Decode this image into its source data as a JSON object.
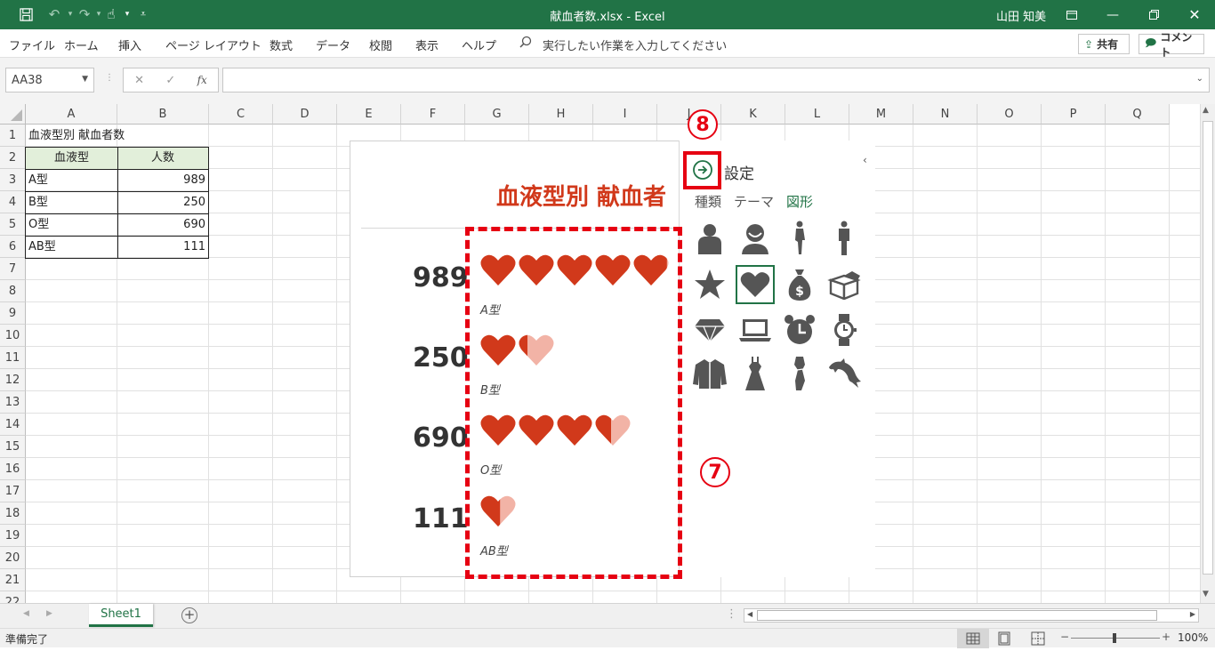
{
  "titlebar": {
    "title": "献血者数.xlsx  -  Excel",
    "user": "山田 知美",
    "colors": {
      "bg": "#217346"
    }
  },
  "menu": {
    "items": [
      "ファイル",
      "ホーム",
      "挿入",
      "ページ レイアウト",
      "数式",
      "データ",
      "校閲",
      "表示",
      "ヘルプ"
    ],
    "tellme": "実行したい作業を入力してください",
    "share": "共有",
    "comment": "コメント"
  },
  "formula": {
    "namebox": "AA38",
    "fx": "fx",
    "value": ""
  },
  "columns": [
    "A",
    "B",
    "C",
    "D",
    "E",
    "F",
    "G",
    "H",
    "I",
    "J",
    "K",
    "L",
    "M",
    "N",
    "O",
    "P",
    "Q"
  ],
  "rows": [
    "1",
    "2",
    "3",
    "4",
    "5",
    "6",
    "7",
    "8",
    "9",
    "10",
    "11",
    "12",
    "13",
    "14",
    "15",
    "16",
    "17",
    "18",
    "19",
    "20",
    "21",
    "22"
  ],
  "sheet": {
    "a1": "血液型別 献血者数",
    "header_a": "血液型",
    "header_b": "人数",
    "r3a": "A型",
    "r3b": "989",
    "r4a": "B型",
    "r4b": "250",
    "r5a": "O型",
    "r5b": "690",
    "r6a": "AB型",
    "r6b": "111"
  },
  "chart_data": {
    "type": "bar",
    "title": "血液型別 献血者",
    "categories": [
      "A型",
      "B型",
      "O型",
      "AB型"
    ],
    "values": [
      989,
      250,
      690,
      111
    ],
    "icon": "heart-icon",
    "color": "#d1391b"
  },
  "chart": {
    "v1": "989",
    "v2": "250",
    "v3": "690",
    "v4": "111",
    "c1": "A型",
    "c2": "B型",
    "c3": "O型",
    "c4": "AB型"
  },
  "panel": {
    "settings": "設定",
    "tab1": "種類",
    "tab2": "テーマ",
    "tab3": "図形"
  },
  "annotations": {
    "badge7": "7",
    "badge8": "8"
  },
  "sheettab": "Sheet1",
  "status": {
    "ready": "準備完了",
    "zoom": "100%"
  }
}
